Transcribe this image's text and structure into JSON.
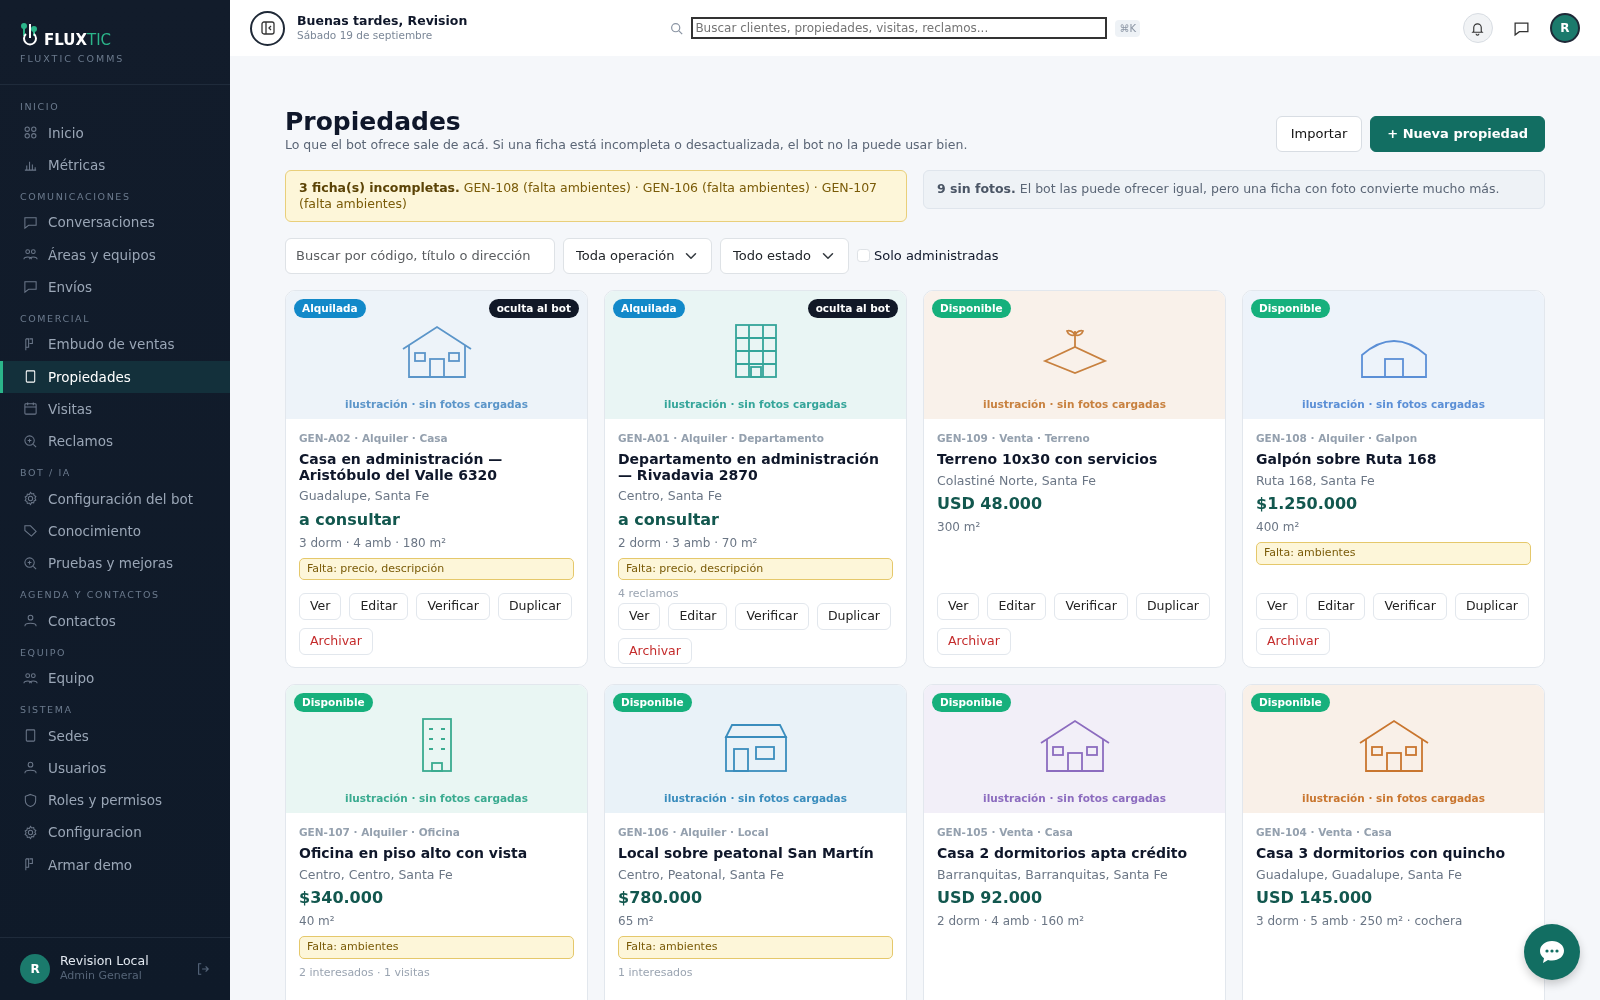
{
  "sidebar": {
    "brand": {
      "name_a": "FLUX",
      "name_b": "TIC",
      "subtitle": "FLUXTIC COMMS"
    },
    "sections": [
      {
        "label": "INICIO",
        "items": [
          {
            "label": "Inicio",
            "kind": "grid",
            "selected": false
          },
          {
            "label": "Métricas",
            "kind": "chart",
            "selected": false
          }
        ]
      },
      {
        "label": "COMUNICACIONES",
        "items": [
          {
            "label": "Conversaciones",
            "kind": "chat",
            "selected": false
          },
          {
            "label": "Áreas y equipos",
            "kind": "team",
            "selected": false
          },
          {
            "label": "Envíos",
            "kind": "chat",
            "selected": false
          }
        ]
      },
      {
        "label": "COMERCIAL",
        "items": [
          {
            "label": "Embudo de ventas",
            "kind": "kanban",
            "selected": false
          },
          {
            "label": "Propiedades",
            "kind": "square",
            "selected": true
          },
          {
            "label": "Visitas",
            "kind": "calendar",
            "selected": false
          },
          {
            "label": "Reclamos",
            "kind": "search",
            "selected": false
          }
        ]
      },
      {
        "label": "BOT / IA",
        "items": [
          {
            "label": "Configuración del bot",
            "kind": "gear",
            "selected": false
          },
          {
            "label": "Conocimiento",
            "kind": "tag",
            "selected": false
          },
          {
            "label": "Pruebas y mejoras",
            "kind": "search",
            "selected": false
          }
        ]
      },
      {
        "label": "AGENDA Y CONTACTOS",
        "items": [
          {
            "label": "Contactos",
            "kind": "person",
            "selected": false
          }
        ]
      },
      {
        "label": "EQUIPO",
        "items": [
          {
            "label": "Equipo",
            "kind": "team",
            "selected": false
          }
        ]
      },
      {
        "label": "SISTEMA",
        "items": [
          {
            "label": "Sedes",
            "kind": "square",
            "selected": false
          },
          {
            "label": "Usuarios",
            "kind": "person",
            "selected": false
          },
          {
            "label": "Roles y permisos",
            "kind": "shield",
            "selected": false
          },
          {
            "label": "Configuracion",
            "kind": "gear",
            "selected": false
          },
          {
            "label": "Armar demo",
            "kind": "kanban",
            "selected": false
          }
        ]
      }
    ],
    "user": {
      "initial": "R",
      "name": "Revision Local",
      "role": "Admin General"
    }
  },
  "header": {
    "greeting": "Buenas tardes, Revision",
    "date": "Sábado 19 de septiembre",
    "search": {
      "placeholder": "Buscar clientes, propiedades, visitas, reclamos..."
    },
    "shortcut": "⌘K",
    "avatar": "R"
  },
  "page": {
    "title": "Propiedades",
    "subtitle": "Lo que el bot ofrece sale de acá. Si una ficha está incompleta o desactualizada, el bot no la puede usar bien.",
    "buttons": [
      {
        "label": "Importar",
        "kind": "secondary"
      },
      {
        "label": "+ Nueva propiedad",
        "kind": "primary"
      }
    ]
  },
  "alerts": [
    {
      "kind": "warning",
      "text": "**3 ficha(s) incompletas.** GEN-108 (falta ambientes) · GEN-106 (falta ambientes) · GEN-107 (falta ambientes)"
    },
    {
      "kind": "info",
      "text": "**9 sin fotos.** El bot las puede ofrecer igual, pero una ficha con foto convierte mucho más."
    }
  ],
  "filters": {
    "search": {
      "placeholder": "Buscar por código, título o dirección"
    },
    "selects": [
      "Toda operación",
      "Todo estado"
    ],
    "checkbox": {
      "label": "Solo administradas",
      "checked": false
    }
  },
  "cards": [
    {
      "status": {
        "label": "Alquilada",
        "kind": "rented"
      },
      "hidden_badge": "oculta al bot",
      "illustration": {
        "kind": "house",
        "color": "#5b95c9",
        "caption": "ilustración · sin fotos cargadas"
      },
      "meta": "GEN-A02 · Alquiler · Casa",
      "title": "Casa en administración — Aristóbulo del Valle 6320",
      "location": "Guadalupe, Santa Fe",
      "price": "a consultar",
      "details": "3 dorm · 4 amb · 180 m²",
      "missing": "Falta: precio, descripción",
      "actions": [
        {
          "label": "Ver",
          "kind": "normal"
        },
        {
          "label": "Editar",
          "kind": "normal"
        },
        {
          "label": "Verificar",
          "kind": "normal"
        },
        {
          "label": "Duplicar",
          "kind": "normal"
        },
        {
          "label": "Archivar",
          "kind": "danger"
        }
      ]
    },
    {
      "status": {
        "label": "Alquilada",
        "kind": "rented"
      },
      "hidden_badge": "oculta al bot",
      "illustration": {
        "kind": "apartment",
        "color": "#35a59a",
        "caption": "ilustración · sin fotos cargadas"
      },
      "meta": "GEN-A01 · Alquiler · Departamento",
      "title": "Departamento en administración — Rivadavia 2870",
      "location": "Centro, Santa Fe",
      "price": "a consultar",
      "details": "2 dorm · 3 amb · 70 m²",
      "missing": "Falta: precio, descripción",
      "note": "4 reclamos",
      "actions": [
        {
          "label": "Ver",
          "kind": "normal"
        },
        {
          "label": "Editar",
          "kind": "normal"
        },
        {
          "label": "Verificar",
          "kind": "normal"
        },
        {
          "label": "Duplicar",
          "kind": "normal"
        },
        {
          "label": "Archivar",
          "kind": "danger"
        }
      ]
    },
    {
      "status": {
        "label": "Disponible",
        "kind": "available"
      },
      "illustration": {
        "kind": "land",
        "color": "#c8813f",
        "caption": "ilustración · sin fotos cargadas"
      },
      "meta": "GEN-109 · Venta · Terreno",
      "title": "Terreno 10x30 con servicios",
      "location": "Colastiné Norte, Santa Fe",
      "price": "USD 48.000",
      "details": "300 m²",
      "actions": [
        {
          "label": "Ver",
          "kind": "normal"
        },
        {
          "label": "Editar",
          "kind": "normal"
        },
        {
          "label": "Verificar",
          "kind": "normal"
        },
        {
          "label": "Duplicar",
          "kind": "normal"
        },
        {
          "label": "Archivar",
          "kind": "danger"
        }
      ]
    },
    {
      "status": {
        "label": "Disponible",
        "kind": "available"
      },
      "illustration": {
        "kind": "warehouse",
        "color": "#5b8fd6",
        "caption": "ilustración · sin fotos cargadas"
      },
      "meta": "GEN-108 · Alquiler · Galpon",
      "title": "Galpón sobre Ruta 168",
      "location": "Ruta 168, Santa Fe",
      "price": "$1.250.000",
      "details": "400 m²",
      "missing": "Falta: ambientes",
      "actions": [
        {
          "label": "Ver",
          "kind": "normal"
        },
        {
          "label": "Editar",
          "kind": "normal"
        },
        {
          "label": "Verificar",
          "kind": "normal"
        },
        {
          "label": "Duplicar",
          "kind": "normal"
        },
        {
          "label": "Archivar",
          "kind": "danger"
        }
      ]
    },
    {
      "status": {
        "label": "Disponible",
        "kind": "available"
      },
      "illustration": {
        "kind": "office",
        "color": "#3aab90",
        "caption": "ilustración · sin fotos cargadas"
      },
      "meta": "GEN-107 · Alquiler · Oficina",
      "title": "Oficina en piso alto con vista",
      "location": "Centro, Centro, Santa Fe",
      "price": "$340.000",
      "details": "40 m²",
      "missing": "Falta: ambientes",
      "note": "2 interesados · 1 visitas"
    },
    {
      "status": {
        "label": "Disponible",
        "kind": "available"
      },
      "illustration": {
        "kind": "store",
        "color": "#3a8dbd",
        "caption": "ilustración · sin fotos cargadas"
      },
      "meta": "GEN-106 · Alquiler · Local",
      "title": "Local sobre peatonal San Martín",
      "location": "Centro, Peatonal, Santa Fe",
      "price": "$780.000",
      "details": "65 m²",
      "missing": "Falta: ambientes",
      "note": "1 interesados"
    },
    {
      "status": {
        "label": "Disponible",
        "kind": "available"
      },
      "illustration": {
        "kind": "house",
        "color": "#8c6cbf",
        "caption": "ilustración · sin fotos cargadas"
      },
      "meta": "GEN-105 · Venta · Casa",
      "title": "Casa 2 dormitorios apta crédito",
      "location": "Barranquitas, Barranquitas, Santa Fe",
      "price": "USD 92.000",
      "details": "2 dorm · 4 amb · 160 m²"
    },
    {
      "status": {
        "label": "Disponible",
        "kind": "available"
      },
      "illustration": {
        "kind": "house",
        "color": "#c9762f",
        "caption": "ilustración · sin fotos cargadas"
      },
      "meta": "GEN-104 · Venta · Casa",
      "title": "Casa 3 dormitorios con quincho",
      "location": "Guadalupe, Guadalupe, Santa Fe",
      "price": "USD 145.000",
      "details": "3 dorm · 5 amb · 250 m² · cochera"
    }
  ]
}
